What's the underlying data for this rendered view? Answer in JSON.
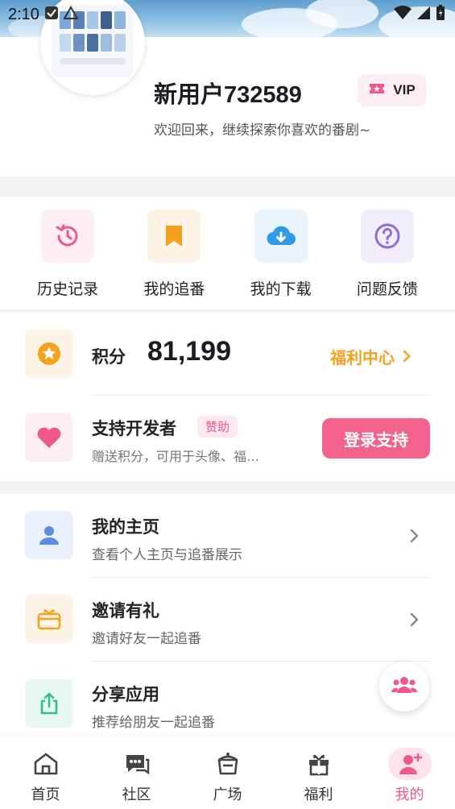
{
  "status_bar": {
    "time": "2:10"
  },
  "profile": {
    "username": "新用户732589",
    "welcome": "欢迎回来，继续探索你喜欢的番剧~",
    "vip_label": "VIP"
  },
  "quick_actions": [
    {
      "label": "历史记录",
      "icon": "history-icon",
      "color": "#f0588a",
      "bg": "#fdeef2"
    },
    {
      "label": "我的追番",
      "icon": "bookmark-icon",
      "color": "#f7a01c",
      "bg": "#fef4e6"
    },
    {
      "label": "我的下载",
      "icon": "cloud-download-icon",
      "color": "#2f9be8",
      "bg": "#e8f3fc"
    },
    {
      "label": "问题反馈",
      "icon": "help-icon",
      "color": "#8e6ae0",
      "bg": "#f1edfb"
    }
  ],
  "points": {
    "label": "积分",
    "value": "81,199",
    "link_label": "福利中心"
  },
  "support": {
    "title": "支持开发者",
    "tag": "赞助",
    "desc": "赠送积分，可用于头像、福…",
    "button": "登录支持"
  },
  "menu": [
    {
      "title": "我的主页",
      "desc": "查看个人主页与追番展示",
      "icon": "user-icon"
    },
    {
      "title": "邀请有礼",
      "desc": "邀请好友一起追番",
      "icon": "gift-box-icon"
    },
    {
      "title": "分享应用",
      "desc": "推荐给朋友一起追番",
      "icon": "share-icon"
    }
  ],
  "tabs": [
    {
      "label": "首页",
      "icon": "home-icon"
    },
    {
      "label": "社区",
      "icon": "chat-icon"
    },
    {
      "label": "广场",
      "icon": "plaza-icon"
    },
    {
      "label": "福利",
      "icon": "gift-icon"
    },
    {
      "label": "我的",
      "icon": "profile-icon",
      "active": true
    }
  ],
  "colors": {
    "accent_pink": "#f3618d",
    "accent_orange": "#f7a01c"
  }
}
